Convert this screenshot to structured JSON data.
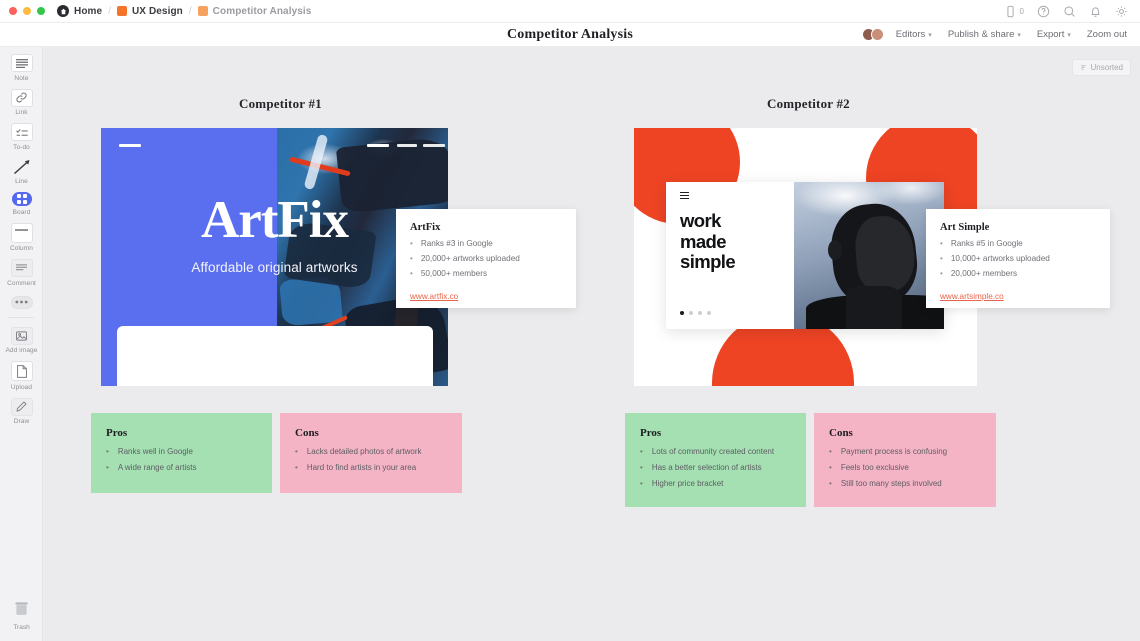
{
  "topbar": {
    "home_label": "Home",
    "crumbs": [
      {
        "label": "UX Design",
        "icon": "orange-square-icon"
      },
      {
        "label": "Competitor Analysis",
        "icon": "orange-square-icon"
      }
    ],
    "separator": "/",
    "comment_count": "0",
    "icons": [
      "comment-icon",
      "help-icon",
      "search-icon",
      "bell-icon",
      "gear-icon"
    ]
  },
  "toolbar": {
    "title": "Competitor Analysis",
    "editors_label": "Editors",
    "publish_label": "Publish & share",
    "export_label": "Export",
    "zoom_label": "Zoom out",
    "caret": "▾"
  },
  "rail": {
    "tools": [
      {
        "label": "Note",
        "icon": "note-icon",
        "selected": false
      },
      {
        "label": "Link",
        "icon": "link-icon",
        "selected": false
      },
      {
        "label": "To-do",
        "icon": "todo-icon",
        "selected": false
      },
      {
        "label": "Line",
        "icon": "line-icon",
        "selected": false
      },
      {
        "label": "Board",
        "icon": "board-icon",
        "selected": true
      },
      {
        "label": "Column",
        "icon": "column-icon",
        "selected": false
      },
      {
        "label": "Comment",
        "icon": "comment-icon",
        "selected": false
      },
      {
        "label": "",
        "icon": "more-icon",
        "selected": false
      },
      {
        "label": "Add image",
        "icon": "add-image-icon",
        "selected": false
      },
      {
        "label": "Upload",
        "icon": "upload-icon",
        "selected": false
      },
      {
        "label": "Draw",
        "icon": "draw-icon",
        "selected": false
      }
    ],
    "trash_label": "Trash"
  },
  "canvas": {
    "unsorted_label": "Unsorted",
    "unsorted_icon": "sort-icon",
    "columns": [
      {
        "title": "Competitor #1"
      },
      {
        "title": "Competitor #2"
      }
    ]
  },
  "mock1": {
    "brand": "ArtFix",
    "tagline": "Affordable original artworks",
    "accent": "#5a6ef0"
  },
  "mock2": {
    "headline": "work made simple",
    "headline_l1": "work",
    "headline_l2": "made",
    "headline_l3": "simple",
    "accent": "#ee4424",
    "menu_icon": "hamburger-icon",
    "carousel_dots": 4,
    "carousel_active": 1
  },
  "info": [
    {
      "title": "ArtFix",
      "bullets": [
        "Ranks #3 in Google",
        "20,000+ artworks uploaded",
        "50,000+ members"
      ],
      "link": "www.artfix.co"
    },
    {
      "title": "Art Simple",
      "bullets": [
        "Ranks #5 in Google",
        "10,000+ artworks uploaded",
        "20,000+ members"
      ],
      "link": "www.artsimple.co"
    }
  ],
  "proscons": [
    {
      "pros_title": "Pros",
      "pros": [
        "Ranks well in Google",
        "A wide range of artists"
      ],
      "cons_title": "Cons",
      "cons": [
        "Lacks detailed photos of artwork",
        "Hard to find artists in your area"
      ]
    },
    {
      "pros_title": "Pros",
      "pros": [
        "Lots of community created content",
        "Has a better selection of artists",
        "Higher price bracket"
      ],
      "cons_title": "Cons",
      "cons": [
        "Payment process is confusing",
        "Feels too exclusive",
        "Still too many steps involved"
      ]
    }
  ],
  "colors": {
    "pros_bg": "#a5e0b2",
    "cons_bg": "#f4b4c6",
    "canvas_bg": "#ebebed",
    "link": "#e8644a"
  },
  "bullet": "•"
}
